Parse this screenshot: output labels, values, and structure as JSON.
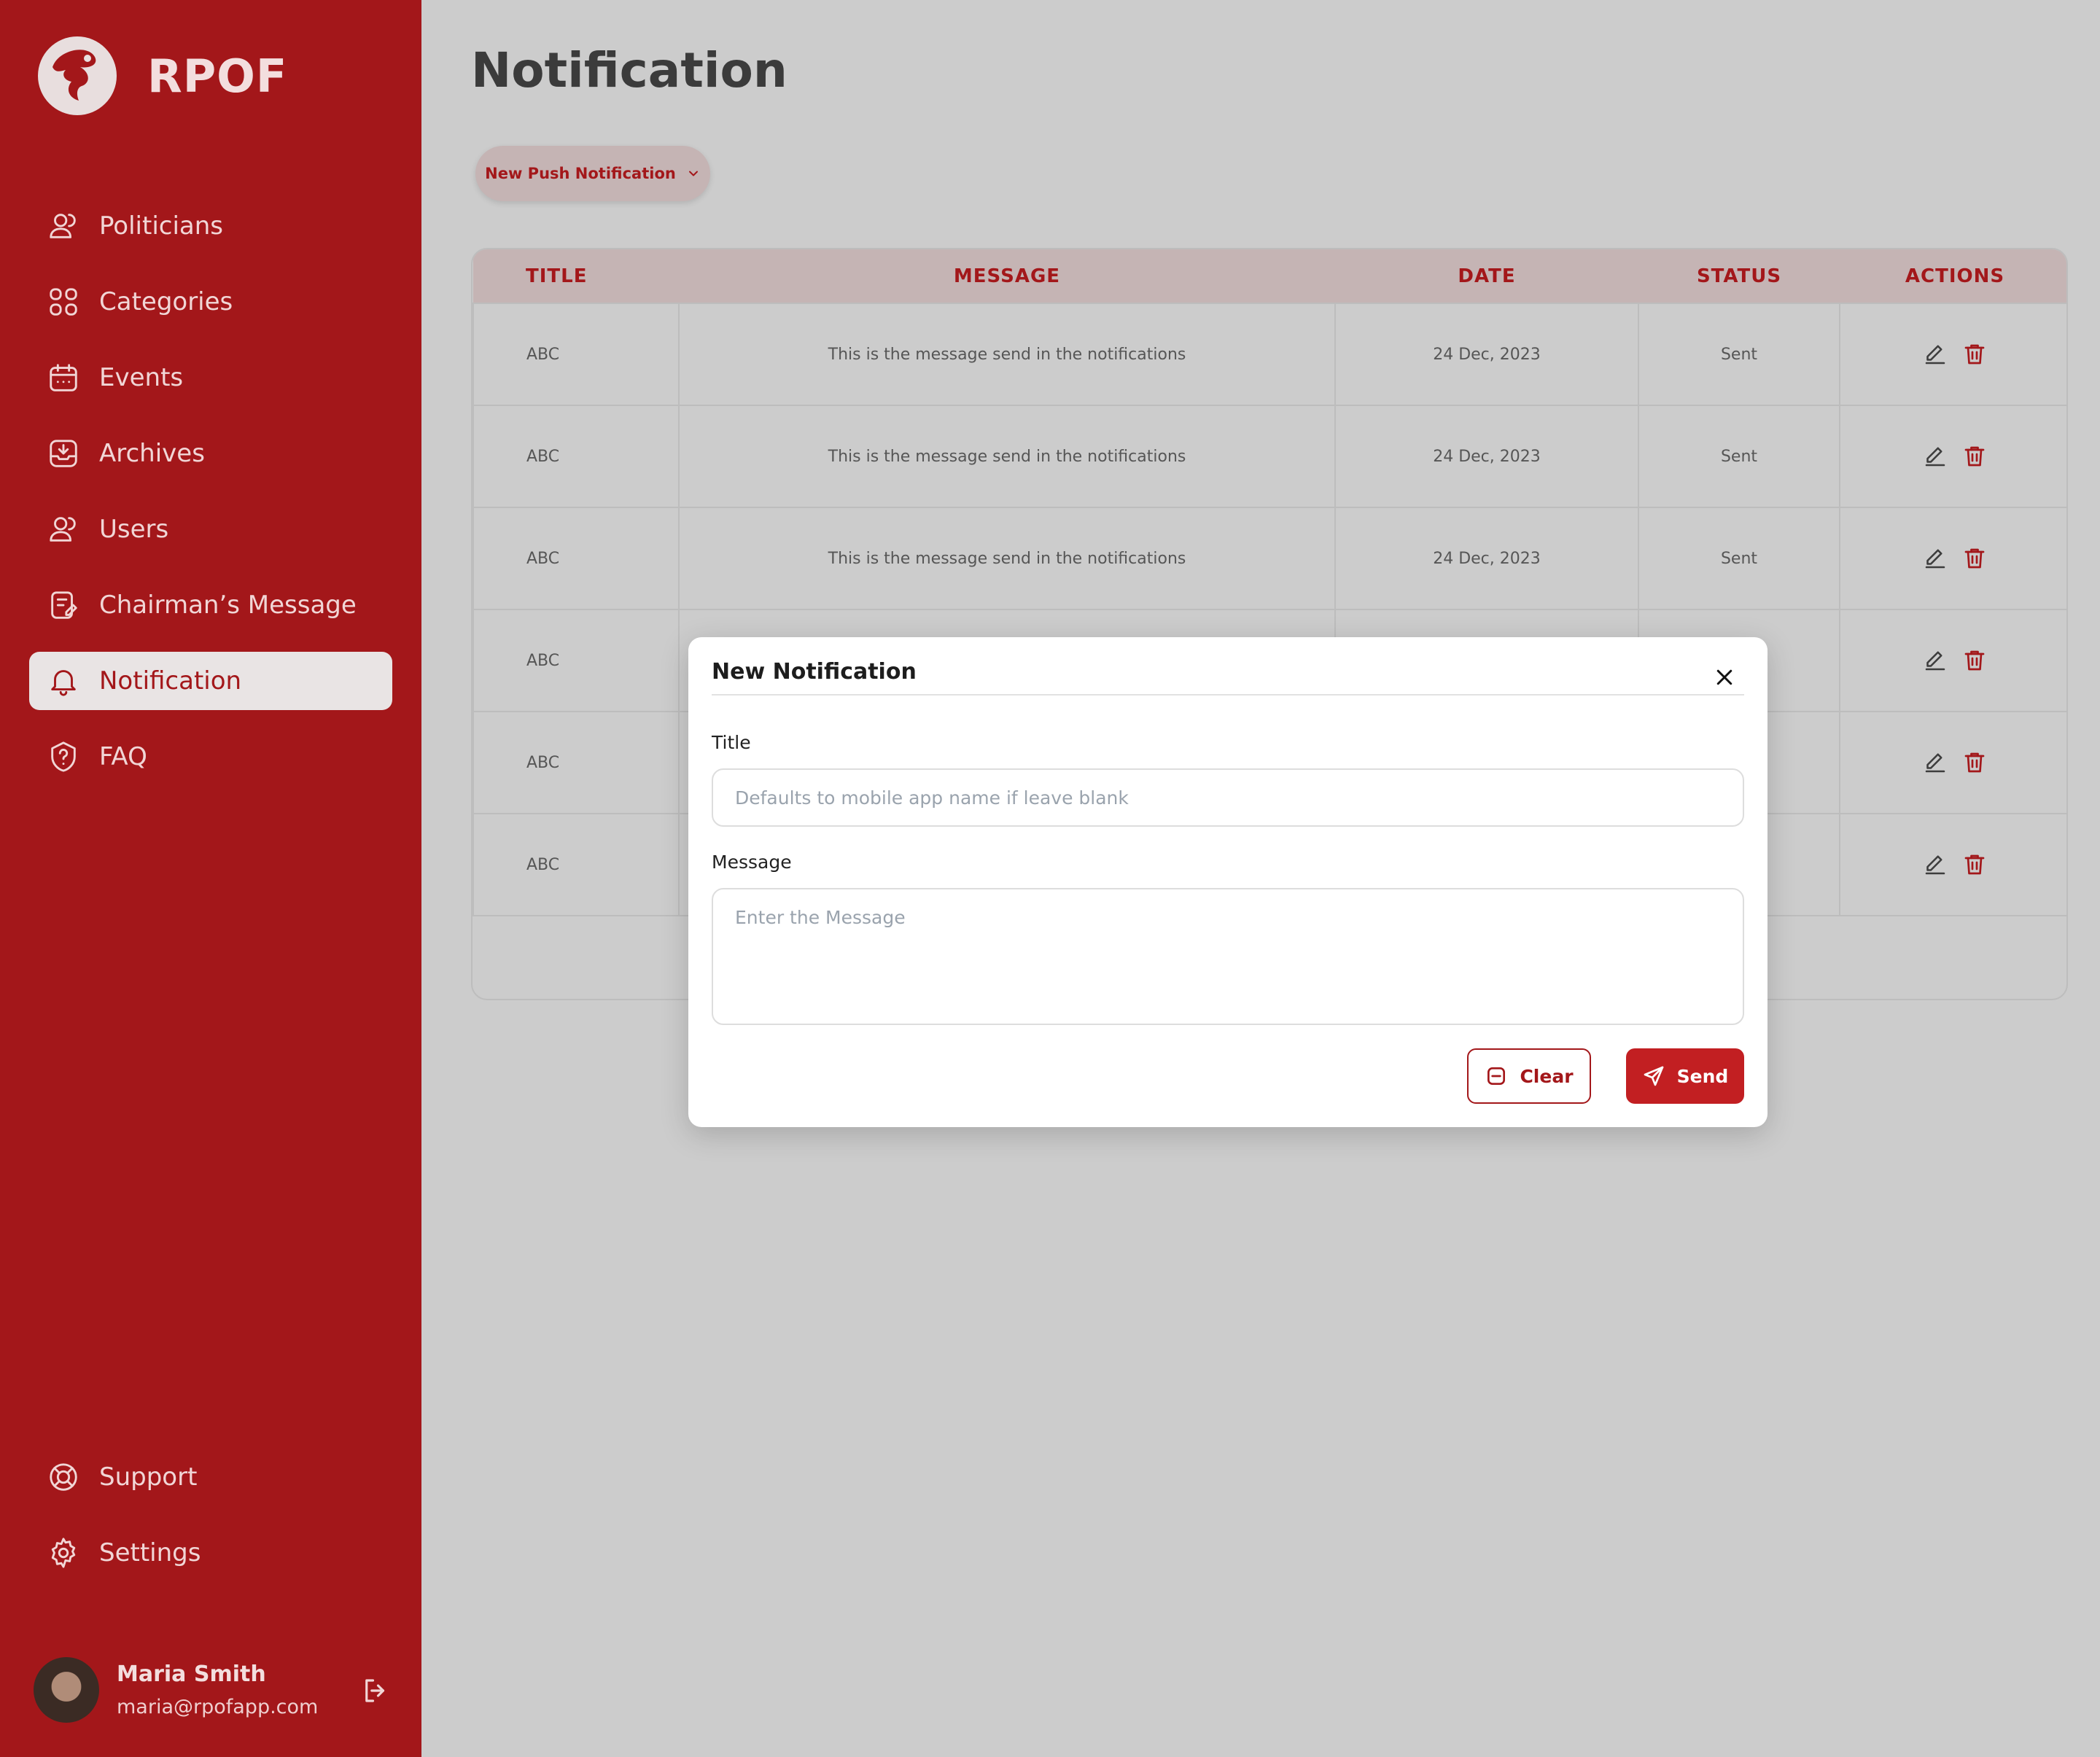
{
  "brand": {
    "name": "RPOF"
  },
  "sidebar": {
    "items": [
      {
        "label": "Politicians",
        "icon": "users-icon"
      },
      {
        "label": "Categories",
        "icon": "grid-icon"
      },
      {
        "label": "Events",
        "icon": "calendar-icon"
      },
      {
        "label": "Archives",
        "icon": "archive-icon"
      },
      {
        "label": "Users",
        "icon": "users-icon"
      },
      {
        "label": "Chairman’s Message",
        "icon": "note-icon"
      },
      {
        "label": "Notification",
        "icon": "bell-icon",
        "active": true
      },
      {
        "label": "FAQ",
        "icon": "help-icon"
      }
    ],
    "bottom_items": [
      {
        "label": "Support",
        "icon": "lifebuoy-icon"
      },
      {
        "label": "Settings",
        "icon": "gear-icon"
      }
    ],
    "user": {
      "name": "Maria Smith",
      "email": "maria@rpofapp.com"
    }
  },
  "page": {
    "title": "Notification",
    "push_button_label": "New Push Notification"
  },
  "table": {
    "headers": [
      "TITLE",
      "MESSAGE",
      "DATE",
      "STATUS",
      "ACTIONS"
    ],
    "rows": [
      {
        "title": "ABC",
        "message": "This is the message send in the notifications",
        "date": "24 Dec, 2023",
        "status": "Sent"
      },
      {
        "title": "ABC",
        "message": "This is the message send in the notifications",
        "date": "24 Dec, 2023",
        "status": "Sent"
      },
      {
        "title": "ABC",
        "message": "This is the message send in the notifications",
        "date": "24 Dec, 2023",
        "status": "Sent"
      },
      {
        "title": "ABC",
        "message": "",
        "date": "",
        "status": ""
      },
      {
        "title": "ABC",
        "message": "",
        "date": "",
        "status": ""
      },
      {
        "title": "ABC",
        "message": "",
        "date": "",
        "status": ""
      }
    ]
  },
  "modal": {
    "title": "New Notification",
    "title_label": "Title",
    "title_placeholder": "Defaults to mobile app name if leave blank",
    "message_label": "Message",
    "message_placeholder": "Enter the Message",
    "clear_label": "Clear",
    "send_label": "Send"
  },
  "colors": {
    "brand_red": "#a3171a",
    "send_red": "#c21f22",
    "header_pink": "#c5b4b4",
    "overlay_gray": "#cccccc"
  }
}
